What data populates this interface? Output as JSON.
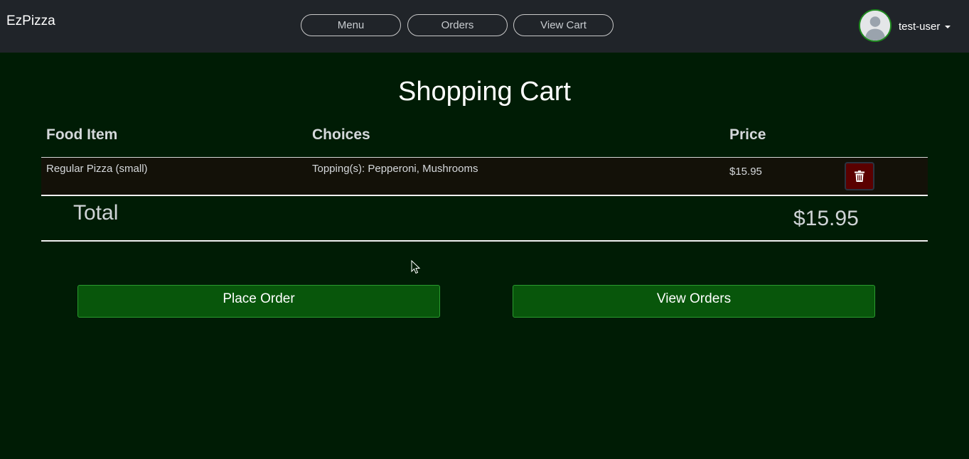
{
  "app": {
    "brand": "EzPizza"
  },
  "nav": {
    "menu_label": "Menu",
    "orders_label": "Orders",
    "view_cart_label": "View Cart"
  },
  "user": {
    "name": "test-user",
    "avatar_icon": "user-avatar-icon"
  },
  "page": {
    "title": "Shopping Cart"
  },
  "cart_table": {
    "columns": [
      "Food Item",
      "Choices",
      "Price"
    ],
    "rows": [
      {
        "item": "Regular Pizza (small)",
        "choices": "Topping(s): Pepperoni, Mushrooms",
        "price": "$15.95",
        "delete_icon": "trash-icon"
      }
    ]
  },
  "totals": {
    "label": "Total",
    "value": "$15.95"
  },
  "actions": {
    "place_order_label": "Place Order",
    "view_orders_label": "View Orders"
  },
  "colors": {
    "background": "#001c05",
    "navbar": "#202429",
    "action_button": "#08560b",
    "delete_button": "#5a0000",
    "avatar_border": "#1f8a1f"
  }
}
